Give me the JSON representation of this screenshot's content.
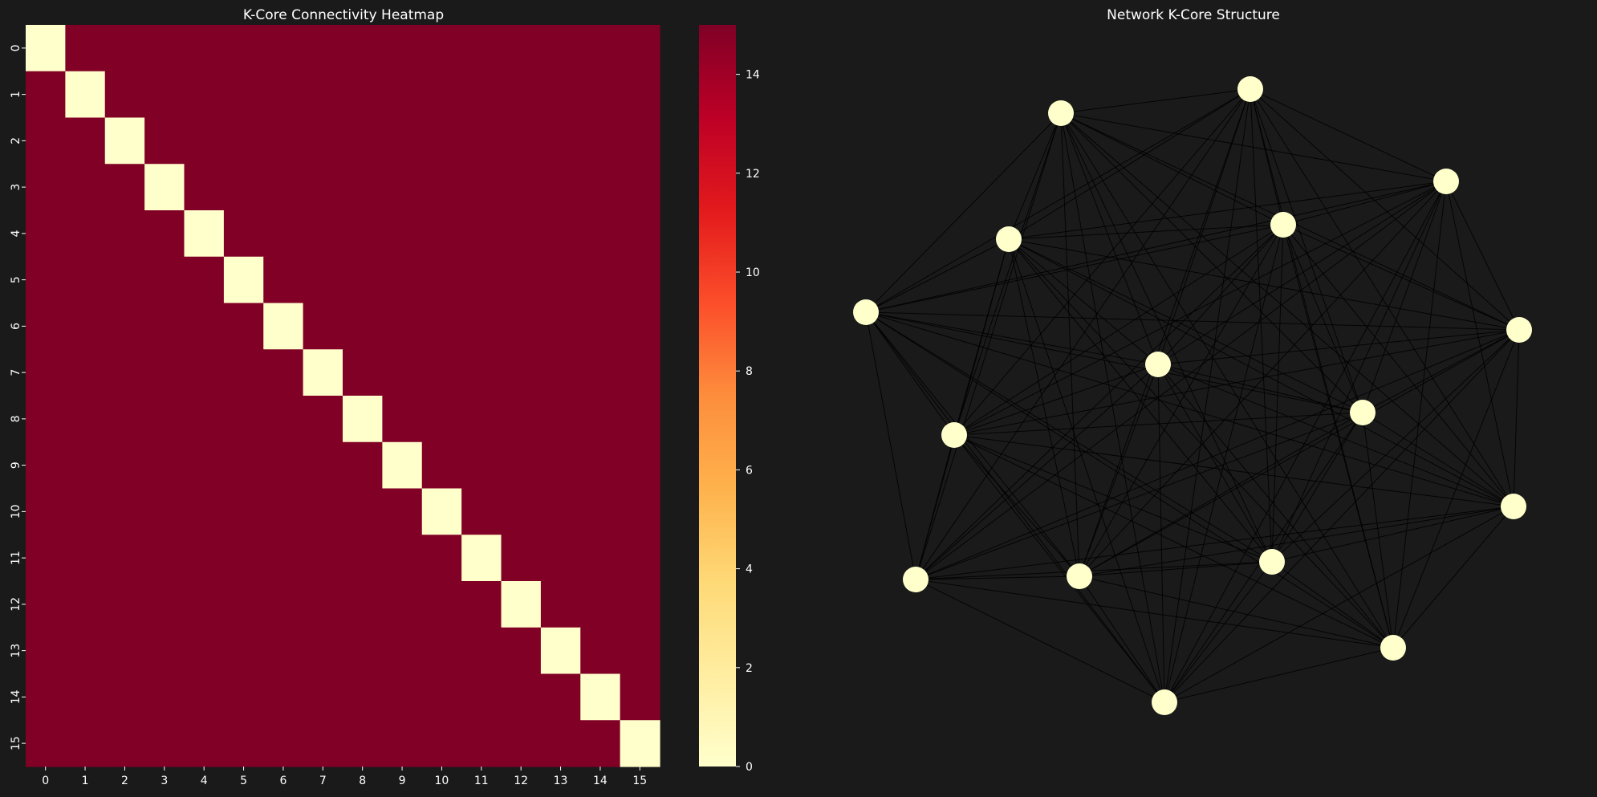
{
  "figure": {
    "background": "#1a1a1a"
  },
  "chart_data": [
    {
      "type": "heatmap",
      "title": "K-Core Connectivity Heatmap",
      "x_categories": [
        "0",
        "1",
        "2",
        "3",
        "4",
        "5",
        "6",
        "7",
        "8",
        "9",
        "10",
        "11",
        "12",
        "13",
        "14",
        "15"
      ],
      "y_categories": [
        "0",
        "1",
        "2",
        "3",
        "4",
        "5",
        "6",
        "7",
        "8",
        "9",
        "10",
        "11",
        "12",
        "13",
        "14",
        "15"
      ],
      "values_rule": "diagonal cells = 0, all off-diagonal cells = 15",
      "diagonal_value": 0,
      "off_diagonal_value": 15,
      "colormap": "YlOrRd",
      "colorbar": {
        "range": [
          0,
          15
        ],
        "ticks": [
          "0",
          "2",
          "4",
          "6",
          "8",
          "10",
          "12",
          "14"
        ]
      },
      "colors": {
        "low": "#ffffcc",
        "high": "#800026"
      }
    },
    {
      "type": "network",
      "title": "Network K-Core Structure",
      "node_count": 16,
      "edges": "complete graph (every pair of nodes connected)",
      "node_color": "#ffffcc",
      "edge_color": "#000000"
    }
  ]
}
